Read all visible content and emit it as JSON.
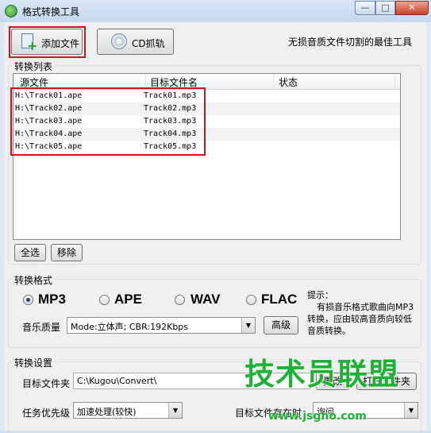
{
  "window": {
    "title": "格式转换工具",
    "min": "—",
    "max": "□",
    "close": "✕"
  },
  "toolbar": {
    "add_file_label": "添加文件",
    "cd_rip_label": "CD抓轨",
    "slogan": "无损音质文件切割的最佳工具"
  },
  "convert_list": {
    "group_title": "转换列表",
    "columns": [
      "源文件",
      "目标文件名",
      "状态"
    ],
    "rows": [
      {
        "source": "H:\\Track01.ape",
        "target": "Track01.mp3",
        "status": ""
      },
      {
        "source": "H:\\Track02.ape",
        "target": "Track02.mp3",
        "status": ""
      },
      {
        "source": "H:\\Track03.ape",
        "target": "Track03.mp3",
        "status": ""
      },
      {
        "source": "H:\\Track04.ape",
        "target": "Track04.mp3",
        "status": ""
      },
      {
        "source": "H:\\Track05.ape",
        "target": "Track05.mp3",
        "status": ""
      }
    ],
    "select_all_label": "全选",
    "remove_label": "移除"
  },
  "format": {
    "group_title": "转换格式",
    "options": [
      "MP3",
      "APE",
      "WAV",
      "FLAC"
    ],
    "selected": "MP3",
    "quality_label": "音乐质量",
    "quality_value": "Mode:立体声; CBR:192Kbps",
    "advanced_label": "高级",
    "hint_title": "提示：",
    "hint_line1": "有损音乐格式歌曲向MP3",
    "hint_line2": "转换，应由较高音质向较低",
    "hint_line3": "音质转换。"
  },
  "settings": {
    "group_title": "转换设置",
    "target_folder_label": "目标文件夹",
    "target_folder_value": "C:\\Kugou\\Convert\\",
    "browse_label": "更改",
    "open_folder_label": "打开文件夹",
    "priority_label": "任务优先级",
    "priority_value": "加速处理(较快)",
    "existing_label": "目标文件存在时",
    "existing_value": "询问"
  },
  "watermark": {
    "logo": "技术员联盟",
    "url": "www.jsgho.com"
  },
  "colors": {
    "highlight": "#d0121d",
    "watermark": "#1fb036"
  }
}
